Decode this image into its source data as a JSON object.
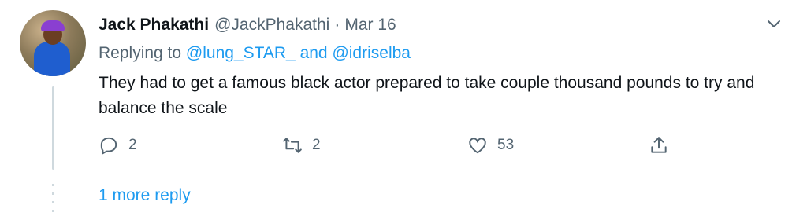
{
  "tweet": {
    "author_name": "Jack Phakathi",
    "handle": "@JackPhakathi",
    "separator": "·",
    "date": "Mar 16",
    "replying_prefix": "Replying to ",
    "mention_1": "@lung_STAR_",
    "replying_and": " and ",
    "mention_2": "@idriselba",
    "text": "They had to get a famous black actor prepared to take couple thousand pounds to try and balance the scale",
    "reply_count": "2",
    "retweet_count": "2",
    "like_count": "53",
    "icons": [
      "reply-icon",
      "retweet-icon",
      "like-icon",
      "share-icon",
      "caret-down-icon"
    ]
  },
  "thread": {
    "more_replies_label": "1 more reply"
  },
  "colors": {
    "link": "#1d9bf0",
    "secondary": "#536471",
    "thread_line": "#cfd9de"
  }
}
